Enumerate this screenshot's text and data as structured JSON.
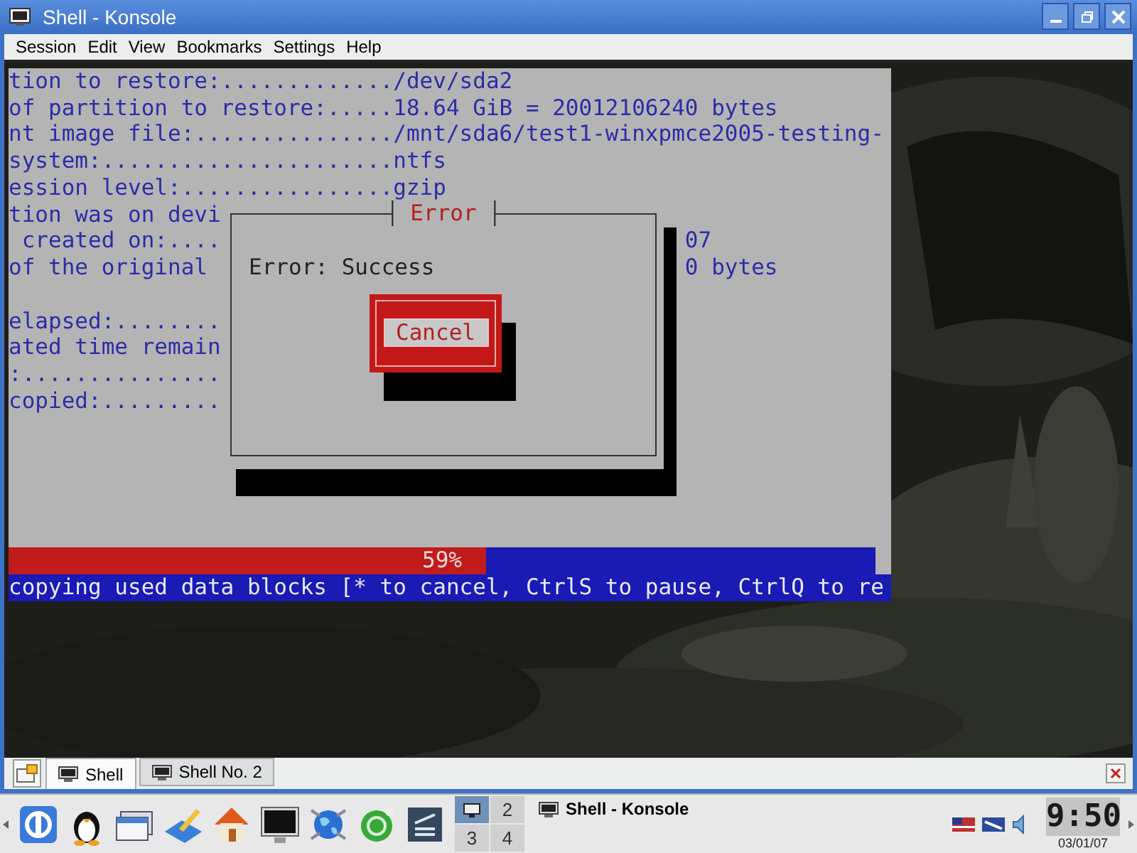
{
  "window": {
    "title": "Shell - Konsole"
  },
  "menu": [
    "Session",
    "Edit",
    "View",
    "Bookmarks",
    "Settings",
    "Help"
  ],
  "terminal": {
    "blocks": [
      [
        {
          "text": "tion to restore:............./dev/sda2"
        },
        {
          "text": "of partition to restore:.....18.64 GiB = 20012106240 bytes"
        },
        {
          "text": "nt image file:.............../mnt/sda6/test1-winxpmce2005-testing-"
        },
        {
          "text": "system:......................ntfs"
        },
        {
          "text": "ession level:................gzip"
        },
        {
          "text": "tion was on devi"
        },
        {
          "text": " created on:....",
          "tail": "07"
        },
        {
          "text": "of the original ",
          "tail": "0 bytes"
        }
      ],
      [
        {
          "text": "elapsed:........"
        },
        {
          "text": "ated time remain"
        },
        {
          "text": ":..............."
        },
        {
          "text": "copied:........."
        }
      ]
    ],
    "dialog": {
      "title": "Error",
      "message": "Error: Success",
      "button": "Cancel"
    },
    "progress": {
      "level": 0.55,
      "label": "59%"
    },
    "status": "copying used data blocks [* to cancel, CtrlS to pause, CtrlQ to re"
  },
  "tabs": [
    {
      "label": "Shell",
      "selected": true
    },
    {
      "label": "Shell No. 2",
      "selected": false
    }
  ],
  "pager": [
    {
      "selected": true
    },
    {
      "label": "2",
      "selected": false
    },
    {
      "label": "3",
      "selected": false
    },
    {
      "label": "4",
      "selected": false
    }
  ],
  "tasks": [
    {
      "label": "Shell - Konsole"
    }
  ],
  "clock": {
    "time": "9:50",
    "date": "03/01/07"
  }
}
